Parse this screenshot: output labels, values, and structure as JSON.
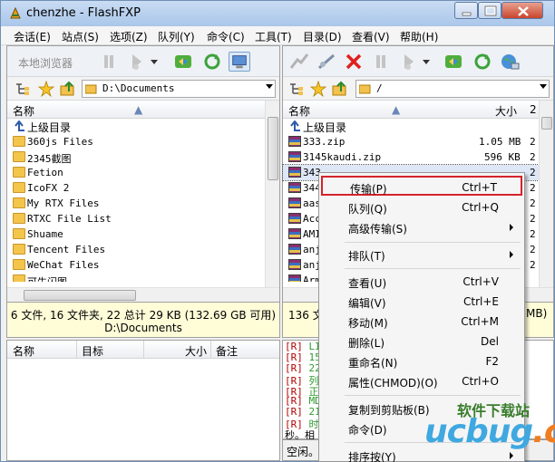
{
  "window": {
    "title": "chenzhe - FlashFXP"
  },
  "menu": [
    "会话(E)",
    "站点(S)",
    "选项(Z)",
    "队列(Y)",
    "命令(C)",
    "工具(T)",
    "目录(D)",
    "查看(V)",
    "帮助(H)"
  ],
  "left": {
    "toolbar_label": "本地浏览器",
    "path": "D:\\Documents",
    "col_name": "名称",
    "updir": "上级目录",
    "folders": [
      "360js Files",
      "2345截图",
      "Fetion",
      "IcoFX 2",
      "My RTX Files",
      "RTXC File List",
      "Shuame",
      "Tencent Files",
      "WeChat Files",
      "可牛闪图"
    ],
    "status_line1": "6 文件, 16 文件夹, 22 总计 29 KB (132.69 GB 可用)",
    "status_line2": "D:\\Documents"
  },
  "right": {
    "path": "/",
    "col_name": "名称",
    "col_size": "大小",
    "col_ext": "2",
    "updir": "上级目录",
    "files": [
      {
        "name": "333.zip",
        "size": "1.05 MB",
        "ext": "2"
      },
      {
        "name": "3145kaudi.zip",
        "size": "596 KB",
        "ext": "2"
      },
      {
        "name": "343",
        "size": "",
        "ext": "2"
      },
      {
        "name": "344",
        "size": "",
        "ext": "2"
      },
      {
        "name": "aas",
        "size": "",
        "ext": "2"
      },
      {
        "name": "Acc",
        "size": "",
        "ext": "2"
      },
      {
        "name": "AMI",
        "size": "",
        "ext": "2"
      },
      {
        "name": "anj",
        "size": "",
        "ext": "2"
      },
      {
        "name": "anj",
        "size": "",
        "ext": "2"
      },
      {
        "name": "Arm",
        "size": "",
        "ext": ""
      }
    ],
    "status_left": "136 文",
    "status_right": "MB)"
  },
  "queue": {
    "col_name": "名称",
    "col_target": "目标",
    "col_size": "大小",
    "col_note": "备注"
  },
  "log": [
    {
      "tag": "[R]",
      "txt": "LI"
    },
    {
      "tag": "[R]",
      "txt": "150"
    },
    {
      "tag": "[R]",
      "txt": "226"
    },
    {
      "tag": "[R]",
      "txt": "列"
    },
    {
      "tag": "[R]",
      "txt": "正"
    },
    {
      "tag": "[R]",
      "txt": "MD"
    },
    {
      "tag": "[R]",
      "txt": "21"
    },
    {
      "tag": "[R]",
      "txt": "时"
    },
    {
      "tag": "",
      "txt": "秒。相"
    }
  ],
  "idle_text": "空闲。(",
  "context_menu": [
    {
      "label": "传输(P)",
      "shortcut": "Ctrl+T",
      "highlight": true
    },
    {
      "label": "队列(Q)",
      "shortcut": "Ctrl+Q"
    },
    {
      "label": "高级传输(S)",
      "shortcut": "",
      "sub": true
    },
    {
      "label": "排队(T)",
      "shortcut": "",
      "sub": true
    },
    {
      "label": "查看(U)",
      "shortcut": "Ctrl+V"
    },
    {
      "label": "编辑(V)",
      "shortcut": "Ctrl+E"
    },
    {
      "label": "移动(M)",
      "shortcut": "Ctrl+M"
    },
    {
      "label": "删除(L)",
      "shortcut": "Del"
    },
    {
      "label": "重命名(N)",
      "shortcut": "F2"
    },
    {
      "label": "属性(CHMOD)(O)",
      "shortcut": "Ctrl+O"
    },
    {
      "label": "复制到剪贴板(B)",
      "shortcut": ""
    },
    {
      "label": "命令(D)",
      "shortcut": ""
    },
    {
      "label": "排序按(Y)",
      "shortcut": "",
      "sub": true
    }
  ],
  "watermark": {
    "small": "软件下载站",
    "big_a": "ucbug",
    "big_b": ".cc"
  }
}
